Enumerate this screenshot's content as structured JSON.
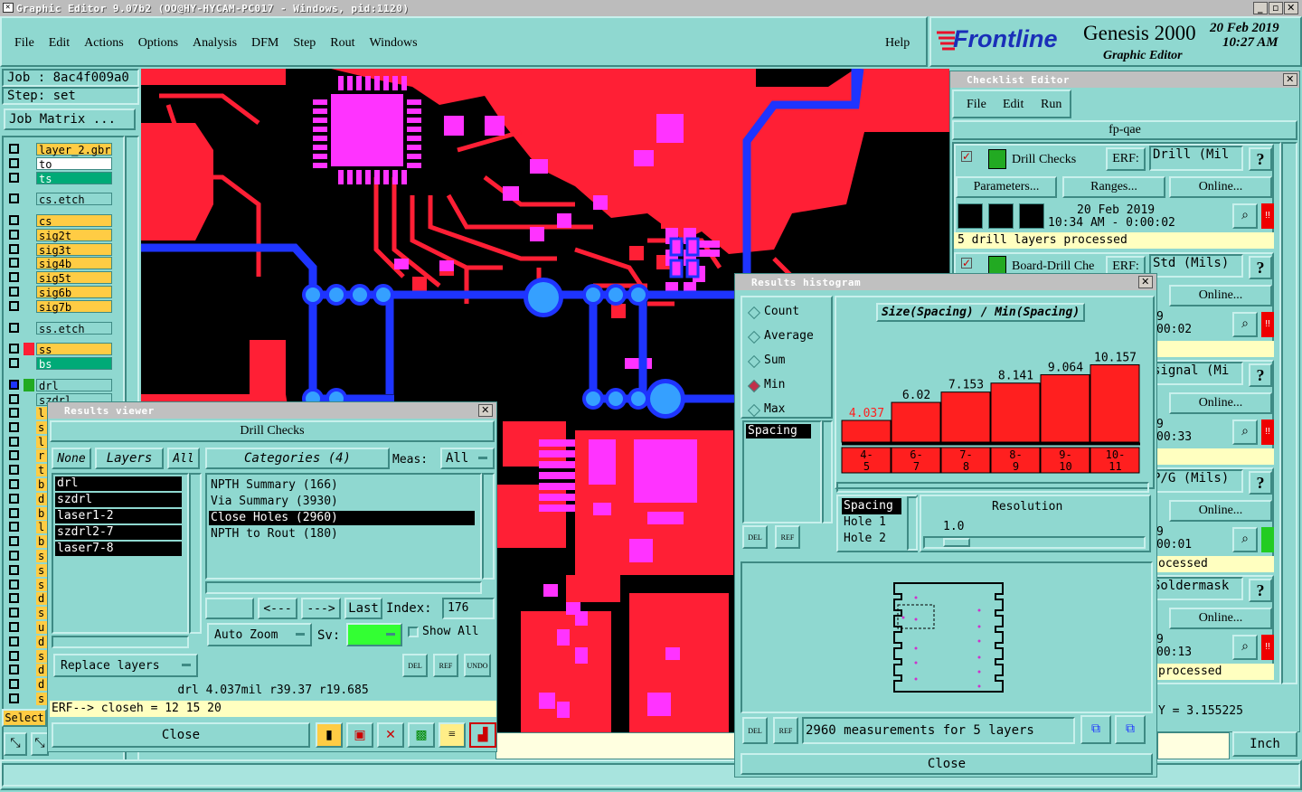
{
  "window": {
    "title": "Graphic Editor 9.07b2 (OO@HY-HYCAM-PC017 - Windows, pid:1120)"
  },
  "menu": {
    "items": [
      "File",
      "Edit",
      "Actions",
      "Options",
      "Analysis",
      "DFM",
      "Step",
      "Rout",
      "Windows"
    ],
    "help": "Help"
  },
  "brand": {
    "logo": "Frontline",
    "product": "Genesis 2000",
    "subtitle": "Graphic Editor",
    "date": "20 Feb 2019",
    "time": "10:27 AM"
  },
  "job": {
    "job_label": "Job : 8ac4f009a0",
    "step_label": "Step: set",
    "matrix_button": "Job Matrix ..."
  },
  "layers": [
    {
      "name": "layer_2.gbr",
      "color": "#ffcc44"
    },
    {
      "name": "to",
      "color": "#ffffff"
    },
    {
      "name": "ts",
      "color": "#00aa77"
    },
    {
      "name": "cs.etch",
      "color": "#8fd8d0"
    },
    {
      "name": "cs",
      "color": "#ffcc44"
    },
    {
      "name": "sig2t",
      "color": "#ffcc44"
    },
    {
      "name": "sig3t",
      "color": "#ffcc44"
    },
    {
      "name": "sig4b",
      "color": "#ffcc44"
    },
    {
      "name": "sig5t",
      "color": "#ffcc44"
    },
    {
      "name": "sig6b",
      "color": "#ffcc44"
    },
    {
      "name": "sig7b",
      "color": "#ffcc44"
    },
    {
      "name": "ss.etch",
      "color": "#8fd8d0"
    },
    {
      "name": "ss",
      "color": "#ffcc44"
    },
    {
      "name": "bs",
      "color": "#00aa77"
    },
    {
      "name": "drl",
      "color": "#8fd8d0"
    },
    {
      "name": "szdrl",
      "color": "#8fd8d0"
    }
  ],
  "layers_lower_letters": [
    "l",
    "s",
    "l",
    "r",
    "t",
    "b",
    "d",
    "b",
    "l",
    "b",
    "s",
    "s",
    "s",
    "d",
    "s",
    "u",
    "d",
    "s",
    "d",
    "d",
    "s"
  ],
  "select_button": "Select",
  "results_viewer": {
    "title": "Results viewer",
    "header": "Drill Checks",
    "none": "None",
    "layers": "Layers",
    "all": "All",
    "categories": "Categories (4)",
    "meas_label": "Meas:",
    "meas_value": "All",
    "layer_list": [
      "drl",
      "szdrl",
      "laser1-2",
      "szdrl2-7",
      "laser7-8"
    ],
    "category_list": [
      "NPTH Summary (166)",
      "Via Summary (3930)",
      "Close Holes (2960)",
      "NPTH to Rout (180)"
    ],
    "selected_category": 2,
    "nav": {
      "prev": "<---",
      "next": "--->",
      "last": "Last",
      "index_label": "Index:",
      "index_value": "176"
    },
    "auto_zoom": "Auto Zoom",
    "sv_label": "Sv:",
    "show_all": "Show All",
    "replace_layers": "Replace layers",
    "del": "DEL",
    "ref": "REF",
    "undo": "UNDO",
    "status": "drl  4.037mil   r39.37   r19.685",
    "erf": "ERF--> closeh = 12 15 20",
    "close": "Close"
  },
  "checklist": {
    "title": "Checklist Editor",
    "menu": [
      "File",
      "Edit",
      "Run"
    ],
    "name": "fp-qae",
    "action": "Drill Checks",
    "erf_label": "ERF:",
    "erf_value": "Drill (Mil",
    "parameters": "Parameters...",
    "ranges": "Ranges...",
    "online": "Online...",
    "date": "20 Feb 2019",
    "time": "10:34 AM - 0:00:02",
    "status": "5 drill layers processed",
    "row2_action": "Board-Drill Che",
    "row2_erf": "Std (Mils)",
    "partial": [
      {
        "erf": "Std (Mils)",
        "time": "9",
        "time2": "00:02",
        "status": ""
      },
      {
        "erf": "signal (Mi",
        "time": "9",
        "time2": "00:33",
        "status": ""
      },
      {
        "erf": "P/G (Mils)",
        "time": "9",
        "time2": "00:01",
        "status": "ocessed"
      },
      {
        "erf": "Soldermask",
        "time": "9",
        "time2": "00:13",
        "status": "processed"
      }
    ],
    "inch": "Inch",
    "coord": "Y = 3.155225"
  },
  "histogram": {
    "title": "Results histogram",
    "modes": [
      "Count",
      "Average",
      "Sum",
      "Min",
      "Max"
    ],
    "selected_mode": "Min",
    "list_item": "Spacing",
    "chart_title": "Size(Spacing) / Min(Spacing)",
    "resolution_label": "Resolution",
    "resolution_value": "1.0",
    "fields": [
      "Spacing",
      "Hole 1",
      "Hole 2"
    ],
    "summary": "2960 measurements for 5 layers",
    "close": "Close",
    "del": "DEL",
    "ref": "REF"
  },
  "chart_data": {
    "type": "bar",
    "title": "Size(Spacing) / Min(Spacing)",
    "categories": [
      "4-\n5",
      "6-\n7",
      "7-\n8",
      "8-\n9",
      "9-\n10",
      "10-\n11"
    ],
    "values": [
      4.037,
      6.02,
      7.153,
      8.141,
      9.064,
      10.157
    ],
    "value_labels": [
      "4.037",
      "6.02",
      "7.153",
      "8.141",
      "9.064",
      "10.157"
    ],
    "ylim": [
      0,
      11
    ],
    "colors": {
      "bar": "#ff1f1f",
      "first_label": "#ff1f1f"
    }
  },
  "colors": {
    "teal": "#8fd8d0",
    "pcb_red": "#ff1f35",
    "pcb_magenta": "#ff33ff",
    "pcb_blue": "#1e34ff",
    "pcb_cyan": "#35a0ff"
  }
}
